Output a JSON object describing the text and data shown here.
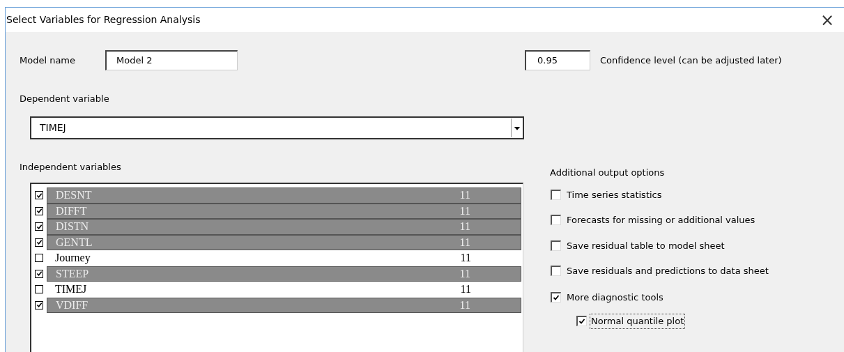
{
  "window": {
    "title": "Select Variables for Regression Analysis",
    "close": "×"
  },
  "model_name": {
    "label": "Model name",
    "value": "Model 2"
  },
  "confidence": {
    "value": "0.95",
    "label": "Confidence level (can be adjusted later)"
  },
  "dependent": {
    "label": "Dependent variable",
    "value": "TIMEJ"
  },
  "independent": {
    "label": "Independent variables",
    "rows": [
      {
        "name": "DESNT",
        "count": "11",
        "checked": true,
        "selected": true
      },
      {
        "name": "DIFFT",
        "count": "11",
        "checked": true,
        "selected": true
      },
      {
        "name": "DISTN",
        "count": "11",
        "checked": true,
        "selected": true
      },
      {
        "name": "GENTL",
        "count": "11",
        "checked": true,
        "selected": true
      },
      {
        "name": "Journey",
        "count": "11",
        "checked": false,
        "selected": false
      },
      {
        "name": "STEEP",
        "count": "11",
        "checked": true,
        "selected": true
      },
      {
        "name": "TIMEJ",
        "count": "11",
        "checked": false,
        "selected": false
      },
      {
        "name": "VDIFF",
        "count": "11",
        "checked": true,
        "selected": true
      }
    ]
  },
  "options": {
    "label": "Additional output options",
    "items": [
      {
        "label": "Time series statistics",
        "checked": false
      },
      {
        "label": "Forecasts for missing or additional values",
        "checked": false
      },
      {
        "label": "Save residual table to model sheet",
        "checked": false
      },
      {
        "label": "Save residuals and predictions to data sheet",
        "checked": false
      },
      {
        "label": "More diagnostic tools",
        "checked": true,
        "children": [
          {
            "label": "Normal quantile plot",
            "checked": true,
            "focused": true
          }
        ]
      }
    ]
  }
}
